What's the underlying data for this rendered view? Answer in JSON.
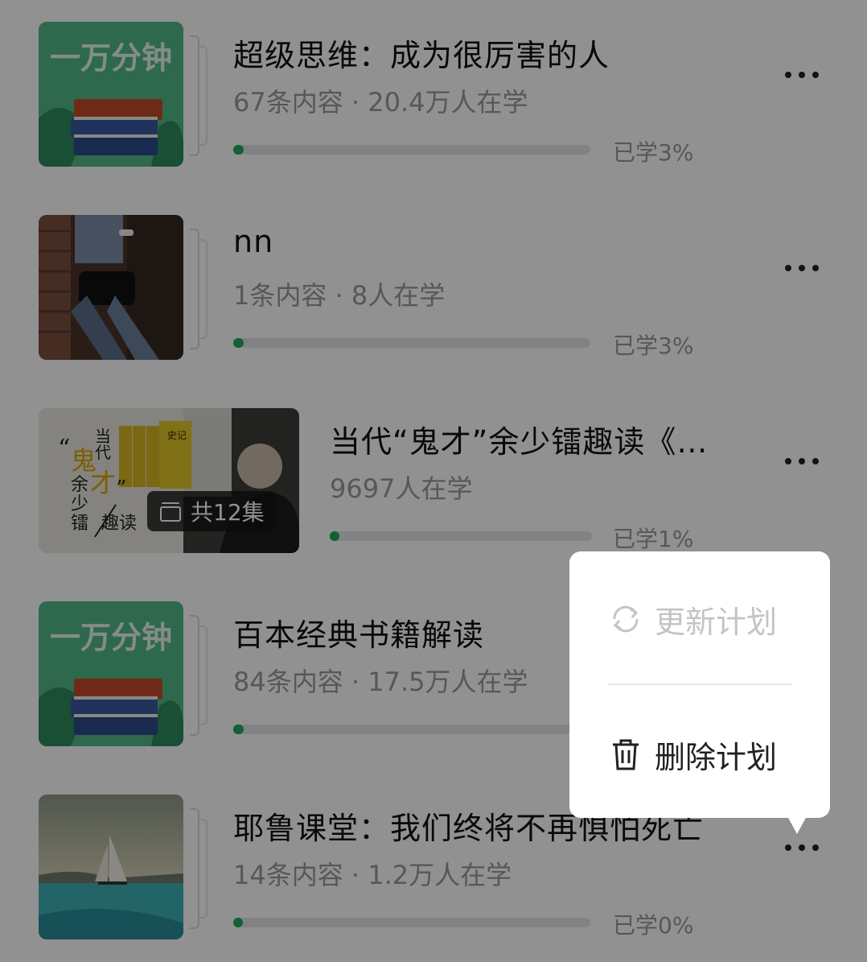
{
  "plans": [
    {
      "title": "超级思维：成为很厉害的人",
      "meta": "67条内容 · 20.4万人在学",
      "progress_label": "已学3%",
      "progress": 0.03,
      "cover": {
        "type": "brand",
        "text": "一万分钟"
      }
    },
    {
      "title": "nn",
      "meta": "1条内容 · 8人在学",
      "progress_label": "已学3%",
      "progress": 0.03,
      "cover": {
        "type": "photo-person"
      }
    },
    {
      "title": "当代“鬼才”余少镭趣读《…",
      "meta": "9697人在学",
      "progress_label": "已学1%",
      "progress": 0.01,
      "cover": {
        "type": "wide",
        "badge": "共12集",
        "art_text": {
          "quote_open": "“",
          "dang": "当",
          "dai": "代",
          "gui": "鬼",
          "cai": "才",
          "quote_close": "”",
          "yu": "余",
          "shao": "少",
          "lei": "镭",
          "qu_du": "趣读",
          "book_title": "史记"
        }
      }
    },
    {
      "title": "百本经典书籍解读",
      "meta": "84条内容 · 17.5万人在学",
      "progress_label": "",
      "progress": 0.03,
      "cover": {
        "type": "brand",
        "text": "一万分钟"
      }
    },
    {
      "title": "耶鲁课堂：我们终将不再惧怕死亡",
      "meta": "14条内容 · 1.2万人在学",
      "progress_label": "已学0%",
      "progress": 0.0,
      "cover": {
        "type": "photo-sea"
      }
    }
  ],
  "popup": {
    "update_label": "更新计划",
    "delete_label": "删除计划"
  },
  "colors": {
    "progress_fill": "#1aad5b",
    "brand_green": "#4db383",
    "overlay": "rgba(0,0,0,0.43)"
  }
}
